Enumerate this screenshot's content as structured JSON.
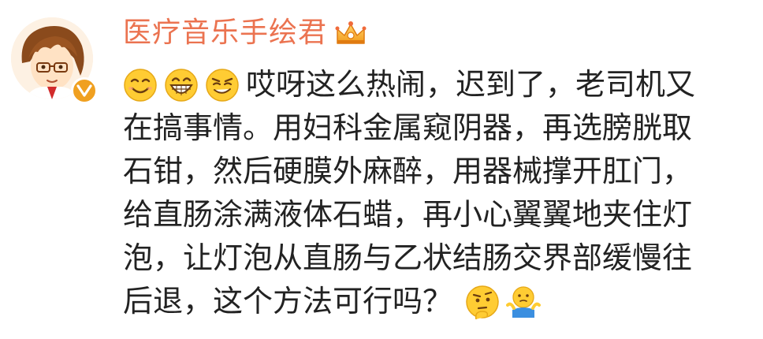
{
  "user": {
    "name": "医疗音乐手绘君",
    "badge_icon": "crown-icon",
    "verified_icon": "verified-v-icon",
    "avatar_icon": "cartoon-avatar-icon"
  },
  "comment": {
    "leading_emojis": [
      "smile-emoji-icon",
      "grin-emoji-icon",
      "smirk-emoji-icon"
    ],
    "lines": [
      "哎呀这么热闹，迟到了，老司机又",
      "在搞事情。用妇科金属窥阴器，再选膀胱取",
      "石钳，然后硬膜外麻醉，用器械撑开肛门，",
      "给直肠涂满液体石蜡，再小心翼翼地夹住灯",
      "泡，让灯泡从直肠与乙状结肠交界部缓慢往",
      "后退，这个方法可行吗？"
    ],
    "trailing_emojis": [
      "thinking-emoji-icon",
      "shrug-emoji-icon"
    ]
  },
  "colors": {
    "username": "#eb7350",
    "text": "#222222",
    "badge": "#f0a020",
    "emoji_face": "#ffcc33"
  }
}
